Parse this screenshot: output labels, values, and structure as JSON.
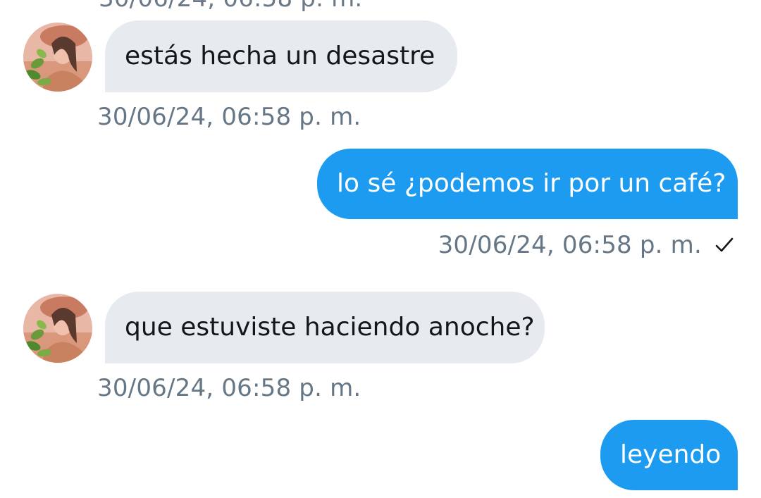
{
  "conversation": {
    "top_timestamp_partial": "30/06/24, 06:58 p. m.",
    "messages": [
      {
        "direction": "incoming",
        "text": "estás hecha un desastre",
        "timestamp": "30/06/24, 06:58 p. m."
      },
      {
        "direction": "outgoing",
        "text": "lo sé ¿podemos ir por un café?",
        "timestamp": "30/06/24, 06:58 p. m.",
        "status_icon": "check-icon"
      },
      {
        "direction": "incoming",
        "text": "que estuviste haciendo anoche?",
        "timestamp": "30/06/24, 06:58 p. m."
      },
      {
        "direction": "outgoing",
        "text": "leyendo"
      }
    ]
  },
  "colors": {
    "incoming_bubble": "#e7ebef",
    "outgoing_bubble": "#1d9bf0",
    "timestamp_text": "#657786",
    "incoming_text": "#14171a",
    "outgoing_text": "#ffffff"
  }
}
